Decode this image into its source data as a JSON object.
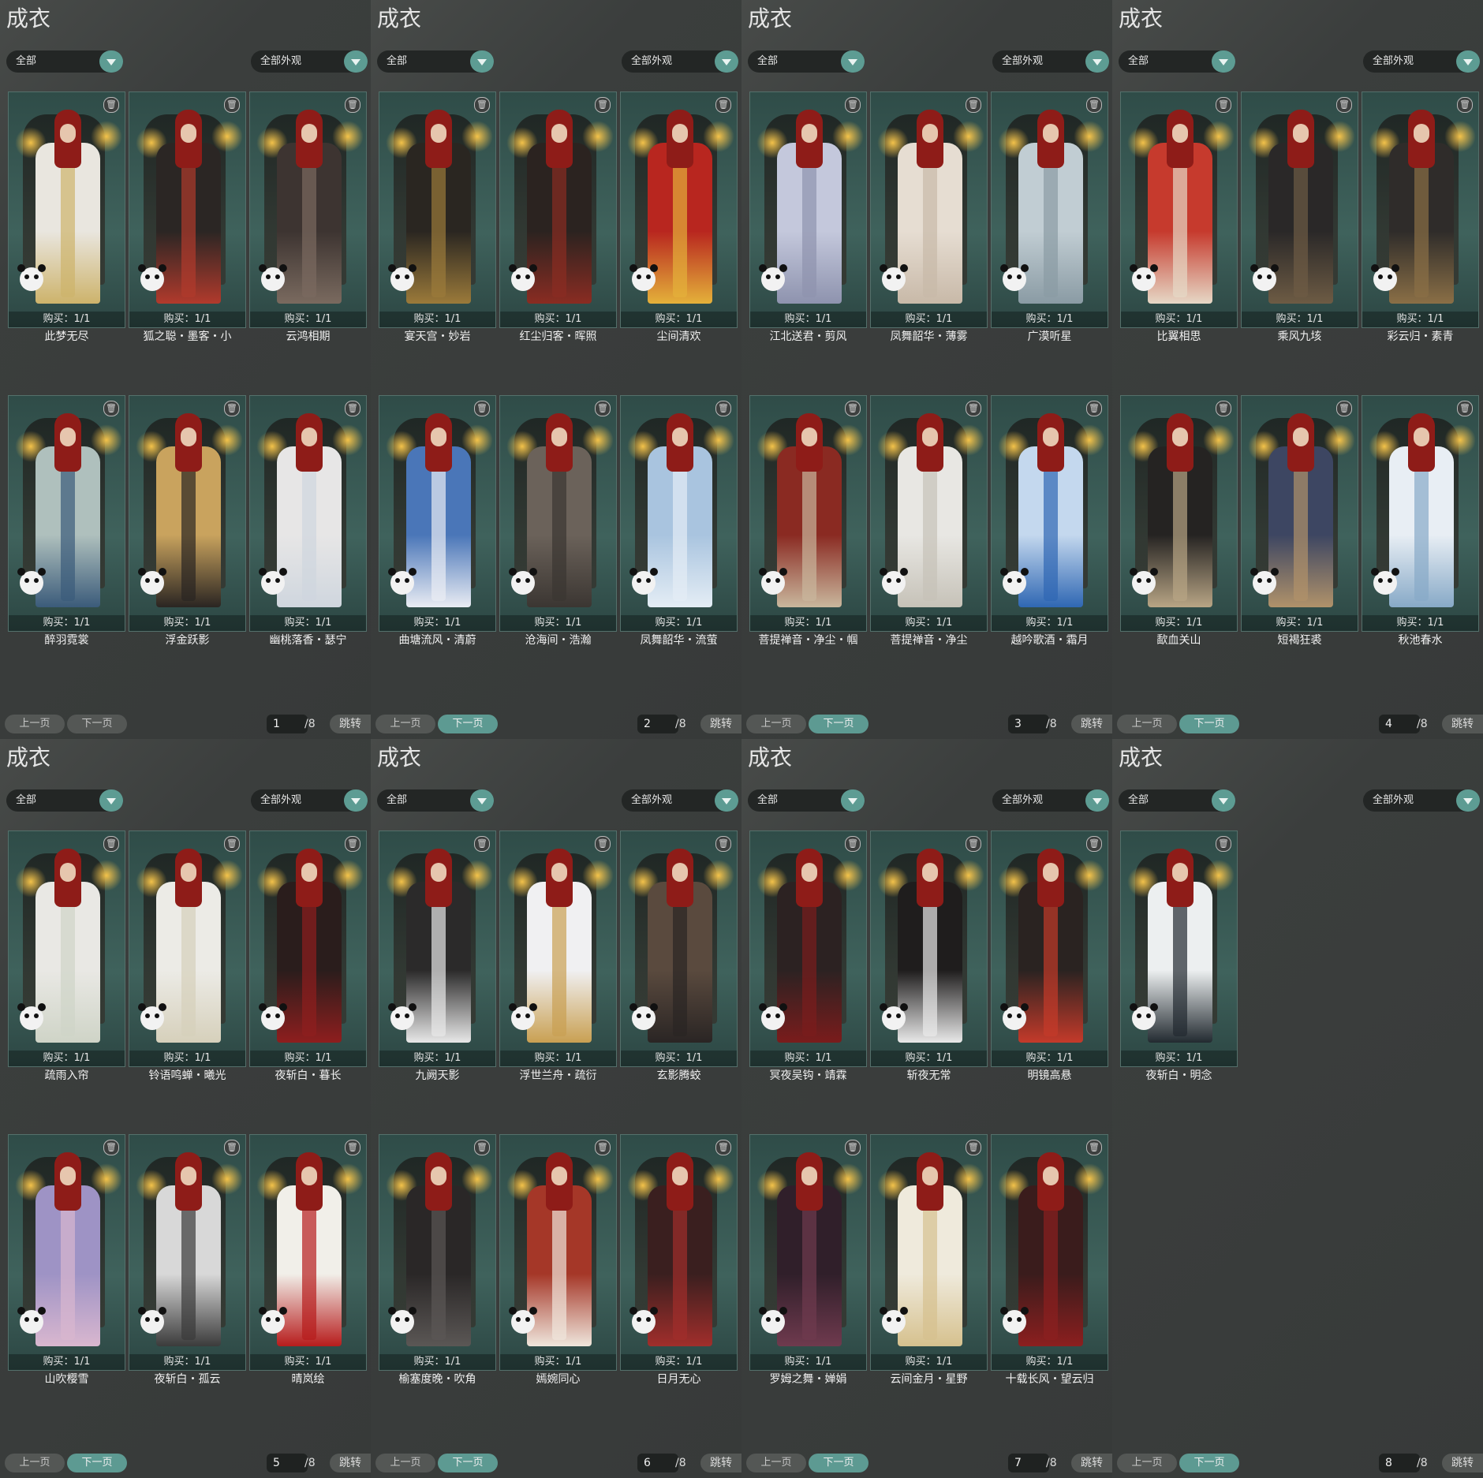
{
  "colors": {
    "accent": "#5d9a92",
    "panel_bg": "#3a3d3c",
    "card_bg": "#2f4c48"
  },
  "icons": {
    "trash": "trash-icon",
    "dropdown": "chevron-down-icon"
  },
  "pages": [
    {
      "title": "成衣",
      "filter1": "全部",
      "filter2": "全部外观",
      "page": "1",
      "total": "/8",
      "prev": "上一页",
      "next": "下一页",
      "jump": "跳转",
      "items": [
        {
          "name": "此梦无尽",
          "buy": "购买：1/1"
        },
        {
          "name": "狐之聪・墨客・小",
          "buy": "购买：1/1"
        },
        {
          "name": "云鸿相期",
          "buy": "购买：1/1"
        },
        {
          "name": "醉羽霓裳",
          "buy": "购买：1/1"
        },
        {
          "name": "浮金跃影",
          "buy": "购买：1/1"
        },
        {
          "name": "幽桃落香・瑟宁",
          "buy": "购买：1/1"
        }
      ]
    },
    {
      "title": "成衣",
      "filter1": "全部",
      "filter2": "全部外观",
      "page": "2",
      "total": "/8",
      "prev": "上一页",
      "next": "下一页",
      "jump": "跳转",
      "items": [
        {
          "name": "宴天宫・妙岩",
          "buy": "购买：1/1"
        },
        {
          "name": "红尘归客・晖照",
          "buy": "购买：1/1"
        },
        {
          "name": "尘间清欢",
          "buy": "购买：1/1"
        },
        {
          "name": "曲塘流风・清蔚",
          "buy": "购买：1/1"
        },
        {
          "name": "沧海间・浩瀚",
          "buy": "购买：1/1"
        },
        {
          "name": "凤舞韶华・流萤",
          "buy": "购买：1/1"
        }
      ]
    },
    {
      "title": "成衣",
      "filter1": "全部",
      "filter2": "全部外观",
      "page": "3",
      "total": "/8",
      "prev": "上一页",
      "next": "下一页",
      "jump": "跳转",
      "items": [
        {
          "name": "江北送君・剪风",
          "buy": "购买：1/1"
        },
        {
          "name": "凤舞韶华・薄雾",
          "buy": "购买：1/1"
        },
        {
          "name": "广漠听星",
          "buy": "购买：1/1"
        },
        {
          "name": "菩提禅音・净尘・帼",
          "buy": "购买：1/1"
        },
        {
          "name": "菩提禅音・净尘",
          "buy": "购买：1/1"
        },
        {
          "name": "越吟歌酒・霜月",
          "buy": "购买：1/1"
        }
      ]
    },
    {
      "title": "成衣",
      "filter1": "全部",
      "filter2": "全部外观",
      "page": "4",
      "total": "/8",
      "prev": "上一页",
      "next": "下一页",
      "jump": "跳转",
      "items": [
        {
          "name": "比翼相思",
          "buy": "购买：1/1"
        },
        {
          "name": "乘风九垓",
          "buy": "购买：1/1"
        },
        {
          "name": "彩云归・素青",
          "buy": "购买：1/1"
        },
        {
          "name": "歃血关山",
          "buy": "购买：1/1"
        },
        {
          "name": "短褐狂裘",
          "buy": "购买：1/1"
        },
        {
          "name": "秋池春水",
          "buy": "购买：1/1"
        }
      ]
    },
    {
      "title": "成衣",
      "filter1": "全部",
      "filter2": "全部外观",
      "page": "5",
      "total": "/8",
      "prev": "上一页",
      "next": "下一页",
      "jump": "跳转",
      "items": [
        {
          "name": "疏雨入帘",
          "buy": "购买：1/1"
        },
        {
          "name": "铃语鸣蝉・曦光",
          "buy": "购买：1/1"
        },
        {
          "name": "夜斩白・暮长",
          "buy": "购买：1/1"
        },
        {
          "name": "山吹樱雪",
          "buy": "购买：1/1"
        },
        {
          "name": "夜斩白・孤云",
          "buy": "购买：1/1"
        },
        {
          "name": "晴岚绘",
          "buy": "购买：1/1"
        }
      ]
    },
    {
      "title": "成衣",
      "filter1": "全部",
      "filter2": "全部外观",
      "page": "6",
      "total": "/8",
      "prev": "上一页",
      "next": "下一页",
      "jump": "跳转",
      "items": [
        {
          "name": "九阙天影",
          "buy": "购买：1/1"
        },
        {
          "name": "浮世兰舟・疏衍",
          "buy": "购买：1/1"
        },
        {
          "name": "玄影腾蛟",
          "buy": "购买：1/1"
        },
        {
          "name": "榆塞度晚・吹角",
          "buy": "购买：1/1"
        },
        {
          "name": "嫣婉同心",
          "buy": "购买：1/1"
        },
        {
          "name": "日月无心",
          "buy": "购买：1/1"
        }
      ]
    },
    {
      "title": "成衣",
      "filter1": "全部",
      "filter2": "全部外观",
      "page": "7",
      "total": "/8",
      "prev": "上一页",
      "next": "下一页",
      "jump": "跳转",
      "items": [
        {
          "name": "冥夜吴钩・靖霖",
          "buy": "购买：1/1"
        },
        {
          "name": "斩夜无常",
          "buy": "购买：1/1"
        },
        {
          "name": "明镜高悬",
          "buy": "购买：1/1"
        },
        {
          "name": "罗姆之舞・婵娟",
          "buy": "购买：1/1"
        },
        {
          "name": "云间金月・星野",
          "buy": "购买：1/1"
        },
        {
          "name": "十载长风・望云归",
          "buy": "购买：1/1"
        }
      ]
    },
    {
      "title": "成衣",
      "filter1": "全部",
      "filter2": "全部外观",
      "page": "8",
      "total": "/8",
      "prev": "上一页",
      "next": "下一页",
      "jump": "跳转",
      "items": [
        {
          "name": "夜斩白・明念",
          "buy": "购买：1/1"
        }
      ]
    }
  ]
}
